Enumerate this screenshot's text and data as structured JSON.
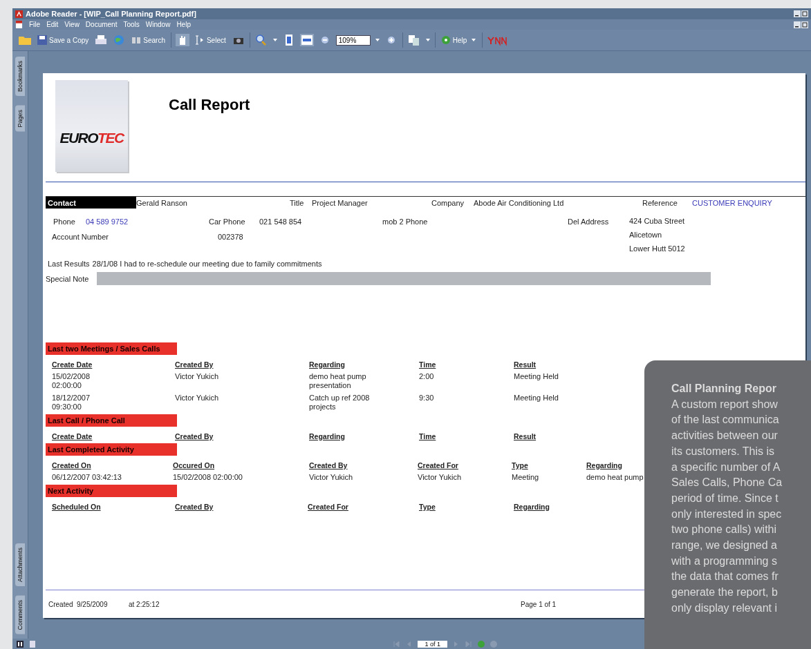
{
  "window": {
    "title": "Adobe Reader - [WIP_Call Planning Report.pdf]"
  },
  "menu": [
    "File",
    "Edit",
    "View",
    "Document",
    "Tools",
    "Window",
    "Help"
  ],
  "toolbar": {
    "save_copy": "Save a Copy",
    "search": "Search",
    "select": "Select",
    "zoom": "109%",
    "help": "Help"
  },
  "side_tabs_top": [
    "Bookmarks",
    "Pages"
  ],
  "side_tabs_bottom": [
    "Attachments",
    "Comments"
  ],
  "report": {
    "logo": {
      "dark": "EURO",
      "red": "TEC"
    },
    "title": "Call Report",
    "contact": {
      "heading": "Contact",
      "name": "Gerald Ranson",
      "title_label": "Title",
      "title": "Project Manager",
      "company_label": "Company",
      "company": "Abode Air Conditioning Ltd",
      "reference_label": "Reference",
      "reference": "CUSTOMER ENQUIRY",
      "phone_label": "Phone",
      "phone": "04 589 9752",
      "car_phone_label": "Car Phone",
      "car_phone": "021 548 854",
      "mob_label": "mob 2 Phone",
      "address_label": "Del Address",
      "address": [
        "424 Cuba Street",
        "Alicetown",
        "Lower Hutt 5012"
      ],
      "account_label": "Account Number",
      "account": "002378",
      "last_results_label": "Last Results",
      "last_results": "28/1/08 I had to re-schedule our meeting due to family commitments",
      "special_note_label": "Special Note"
    },
    "sections": [
      {
        "title": "Last two Meetings / Sales Calls",
        "columns": [
          "Create Date",
          "Created By",
          "Regarding",
          "Time",
          "Result"
        ],
        "rows": [
          [
            "15/02/2008 02:00:00",
            "Victor Yukich",
            "demo heat pump presentation",
            "2:00",
            "Meeting Held"
          ],
          [
            "18/12/2007 09:30:00",
            "Victor Yukich",
            "Catch up ref 2008 projects",
            "9:30",
            "Meeting Held"
          ]
        ]
      },
      {
        "title": "Last Call / Phone Call",
        "columns": [
          "Create Date",
          "Created By",
          "Regarding",
          "Time",
          "Result"
        ]
      },
      {
        "title": "Last Completed Activity",
        "columns": [
          "Created On",
          "Occured On",
          "Created By",
          "Created For",
          "Type",
          "Regarding"
        ],
        "rows": [
          [
            "06/12/2007 03:42:13",
            "15/02/2008 02:00:00",
            "Victor Yukich",
            "Victor Yukich",
            "Meeting",
            "demo heat pump"
          ]
        ]
      },
      {
        "title": "Next Activity",
        "columns": [
          "Scheduled On",
          "Created By",
          "Created For",
          "Type",
          "Regarding"
        ]
      }
    ],
    "footer": {
      "created_label": "Created",
      "created_date": "9/25/2009",
      "created_time": "at  2:25:12",
      "page": "Page 1 of 1"
    }
  },
  "status_bar": {
    "page_field": "1 of 1"
  },
  "overlay": {
    "title": "Call Planning Repor",
    "lines": [
      "A custom report show",
      "of the last communica",
      "activities between our",
      "its customers. This is",
      "a specific number of A",
      "Sales Calls, Phone Ca",
      "period of time. Since t",
      "only interested in spec",
      "two phone calls) withi",
      "range, we designed a",
      "with a programming s",
      "the data that comes fr",
      "generate the report, b",
      "only display relevant i"
    ]
  }
}
